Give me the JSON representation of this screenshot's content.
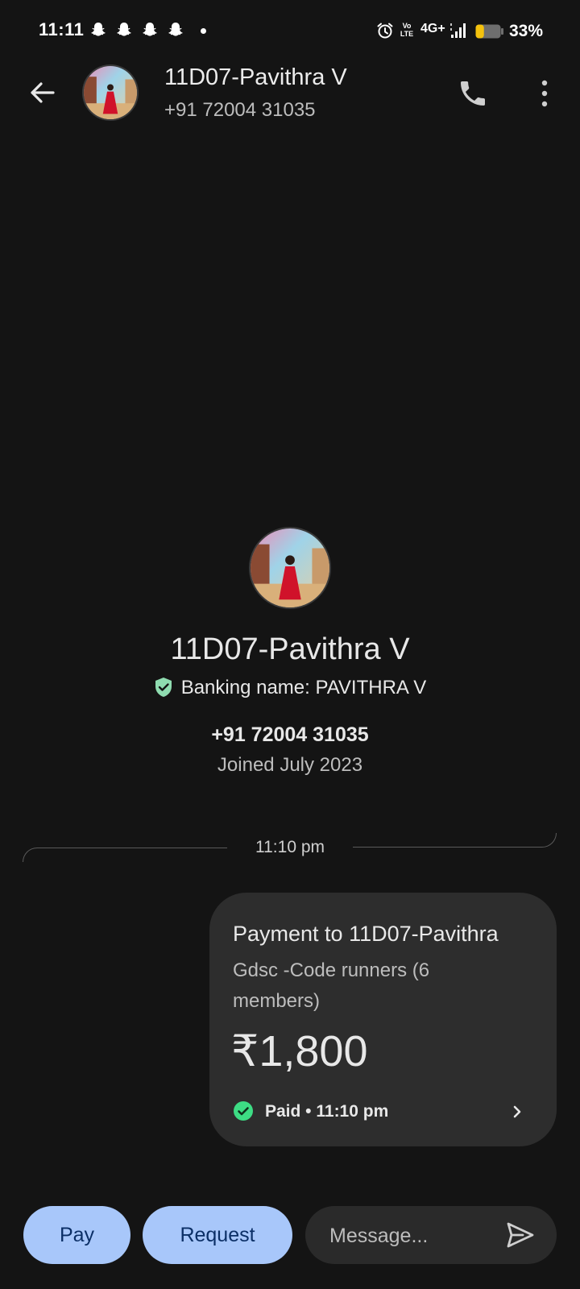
{
  "status_bar": {
    "time": "11:11",
    "network": "4G+",
    "volte_top": "Vo",
    "volte_bottom": "LTE",
    "battery": "33%",
    "battery_level": 0.33
  },
  "header": {
    "contact_name": "11D07-Pavithra V",
    "contact_phone": "+91 72004 31035"
  },
  "profile": {
    "name": "11D07-Pavithra V",
    "banking_name": "Banking name: PAVITHRA V",
    "phone": "+91 72004 31035",
    "joined": "Joined July 2023"
  },
  "conversation": {
    "divider_time": "11:10 pm"
  },
  "payment": {
    "title": "Payment to 11D07-Pavithra",
    "note": "Gdsc -Code runners (6 members)",
    "amount": "₹1,800",
    "status": "Paid • 11:10 pm"
  },
  "bottom_bar": {
    "pay_label": "Pay",
    "request_label": "Request",
    "message_placeholder": "Message..."
  },
  "colors": {
    "background": "#141414",
    "card": "#2d2d2d",
    "button": "#a8c7fa",
    "button_text": "#0b2f66",
    "paid_green": "#3ddc84"
  }
}
